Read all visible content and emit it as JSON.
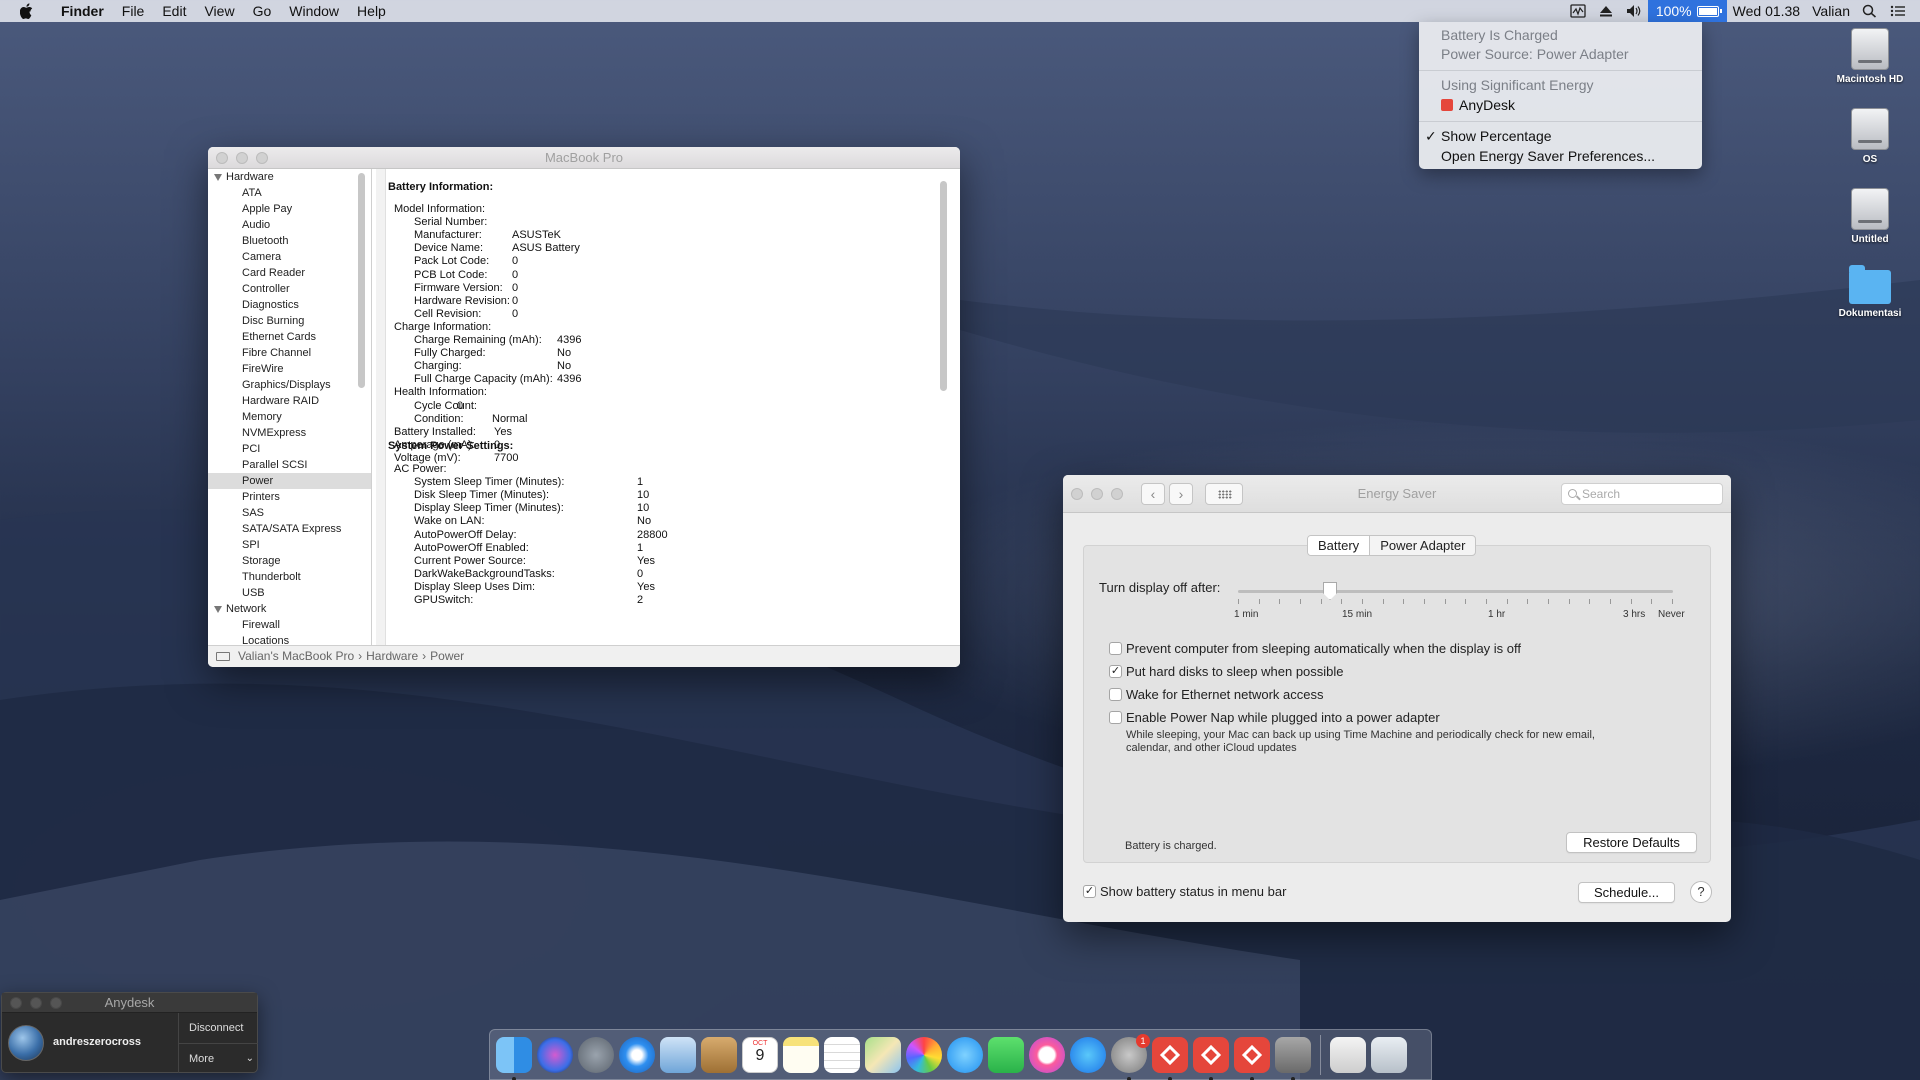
{
  "menubar": {
    "apple_icon": "apple-icon",
    "items": [
      "Finder",
      "File",
      "Edit",
      "View",
      "Go",
      "Window",
      "Help"
    ],
    "battery_percent": "100%",
    "clock": "Wed 01.38",
    "user": "Valian"
  },
  "battery_menu": {
    "status": "Battery Is Charged",
    "source": "Power Source: Power Adapter",
    "energy_heading": "Using Significant Energy",
    "energy_app": "AnyDesk",
    "show_percentage": "Show Percentage",
    "open_prefs": "Open Energy Saver Preferences..."
  },
  "desktop_icons": [
    "Macintosh HD",
    "OS",
    "Untitled",
    "Dokumentasi"
  ],
  "sysinfo": {
    "title": "MacBook Pro",
    "sidebar": {
      "hardware_label": "Hardware",
      "hardware_items": [
        "ATA",
        "Apple Pay",
        "Audio",
        "Bluetooth",
        "Camera",
        "Card Reader",
        "Controller",
        "Diagnostics",
        "Disc Burning",
        "Ethernet Cards",
        "Fibre Channel",
        "FireWire",
        "Graphics/Displays",
        "Hardware RAID",
        "Memory",
        "NVMExpress",
        "PCI",
        "Parallel SCSI",
        "Power",
        "Printers",
        "SAS",
        "SATA/SATA Express",
        "SPI",
        "Storage",
        "Thunderbolt",
        "USB"
      ],
      "selected": "Power",
      "network_label": "Network",
      "network_items": [
        "Firewall",
        "Locations"
      ]
    },
    "battery_info_heading": "Battery Information:",
    "battery_lines": [
      [
        "Model Information:",
        ""
      ],
      [
        "Serial Number:",
        ""
      ],
      [
        "Manufacturer:",
        "ASUSTeK"
      ],
      [
        "Device Name:",
        "ASUS Battery"
      ],
      [
        "Pack Lot Code:",
        "0"
      ],
      [
        "PCB Lot Code:",
        "0"
      ],
      [
        "Firmware Version:",
        "0"
      ],
      [
        "Hardware Revision:",
        "0"
      ],
      [
        "Cell Revision:",
        "0"
      ],
      [
        "Charge Information:",
        ""
      ],
      [
        "Charge Remaining (mAh):",
        "4396"
      ],
      [
        "Fully Charged:",
        "No"
      ],
      [
        "Charging:",
        "No"
      ],
      [
        "Full Charge Capacity (mAh):",
        "4396"
      ],
      [
        "Health Information:",
        ""
      ],
      [
        "Cycle Count:",
        "0"
      ],
      [
        "Condition:",
        "Normal"
      ],
      [
        "Battery Installed:",
        "Yes"
      ],
      [
        "Amperage (mA):",
        "0"
      ],
      [
        "Voltage (mV):",
        "7700"
      ]
    ],
    "power_settings_heading": "System Power Settings:",
    "power_lines": [
      [
        "AC Power:",
        ""
      ],
      [
        "System Sleep Timer (Minutes):",
        "1"
      ],
      [
        "Disk Sleep Timer (Minutes):",
        "10"
      ],
      [
        "Display Sleep Timer (Minutes):",
        "10"
      ],
      [
        "Wake on LAN:",
        "No"
      ],
      [
        "AutoPowerOff Delay:",
        "28800"
      ],
      [
        "AutoPowerOff Enabled:",
        "1"
      ],
      [
        "Current Power Source:",
        "Yes"
      ],
      [
        "DarkWakeBackgroundTasks:",
        "0"
      ],
      [
        "Display Sleep Uses Dim:",
        "Yes"
      ],
      [
        "GPUSwitch:",
        "2"
      ]
    ],
    "path": [
      "Valian's MacBook Pro",
      "Hardware",
      "Power"
    ]
  },
  "energy_saver": {
    "title": "Energy Saver",
    "search_placeholder": "Search",
    "tabs": [
      "Battery",
      "Power Adapter"
    ],
    "slider_label": "Turn display off after:",
    "slider_value_min": 10,
    "tick_labels": [
      "1 min",
      "15 min",
      "1 hr",
      "3 hrs",
      "Never"
    ],
    "options": [
      {
        "label": "Prevent computer from sleeping automatically when the display is off",
        "checked": false
      },
      {
        "label": "Put hard disks to sleep when possible",
        "checked": true
      },
      {
        "label": "Wake for Ethernet network access",
        "checked": false
      },
      {
        "label": "Enable Power Nap while plugged into a power adapter",
        "checked": false
      }
    ],
    "power_nap_desc_1": "While sleeping, your Mac can back up using Time Machine and periodically check for new email,",
    "power_nap_desc_2": "calendar, and other iCloud updates",
    "status": "Battery is charged.",
    "restore_button": "Restore Defaults",
    "show_status_label": "Show battery status in menu bar",
    "show_status_checked": true,
    "schedule_button": "Schedule...",
    "help_label": "?"
  },
  "anydesk": {
    "title": "Anydesk",
    "user": "andreszerocross",
    "disconnect": "Disconnect",
    "more": "More"
  },
  "dock": {
    "apps": [
      "finder-icon",
      "siri-icon",
      "launchpad-icon",
      "safari-icon",
      "preview-icon",
      "notebook-icon",
      "calendar-icon",
      "notes-icon",
      "reminders-icon",
      "maps-icon",
      "photos-icon",
      "messages-icon",
      "facetime-icon",
      "itunes-icon",
      "app-store-icon",
      "system-preferences-icon",
      "anydesk-icon",
      "anydesk-icon",
      "anydesk-icon",
      "utility-icon",
      "documents-icon",
      "trash-icon"
    ],
    "calendar_month": "OCT",
    "calendar_day": "9",
    "sysprefs_badge": "1"
  }
}
